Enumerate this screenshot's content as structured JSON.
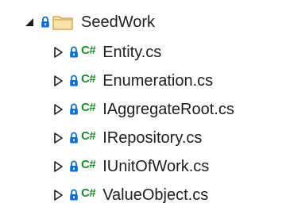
{
  "tree": {
    "folder": {
      "label": "SeedWork",
      "expanded": true,
      "icon": "folder-icon",
      "lock_icon": "lock-icon",
      "expander_icon": "expanded-triangle-icon"
    },
    "files": [
      {
        "label": "Entity.cs",
        "badge": "C#"
      },
      {
        "label": "Enumeration.cs",
        "badge": "C#"
      },
      {
        "label": "IAggregateRoot.cs",
        "badge": "C#"
      },
      {
        "label": "IRepository.cs",
        "badge": "C#"
      },
      {
        "label": "IUnitOfWork.cs",
        "badge": "C#"
      },
      {
        "label": "ValueObject.cs",
        "badge": "C#"
      }
    ],
    "colors": {
      "lock": "#0a6fd8",
      "csharp": "#1a8a2a",
      "folder": "#d7a957",
      "text": "#1e1e1e"
    }
  }
}
